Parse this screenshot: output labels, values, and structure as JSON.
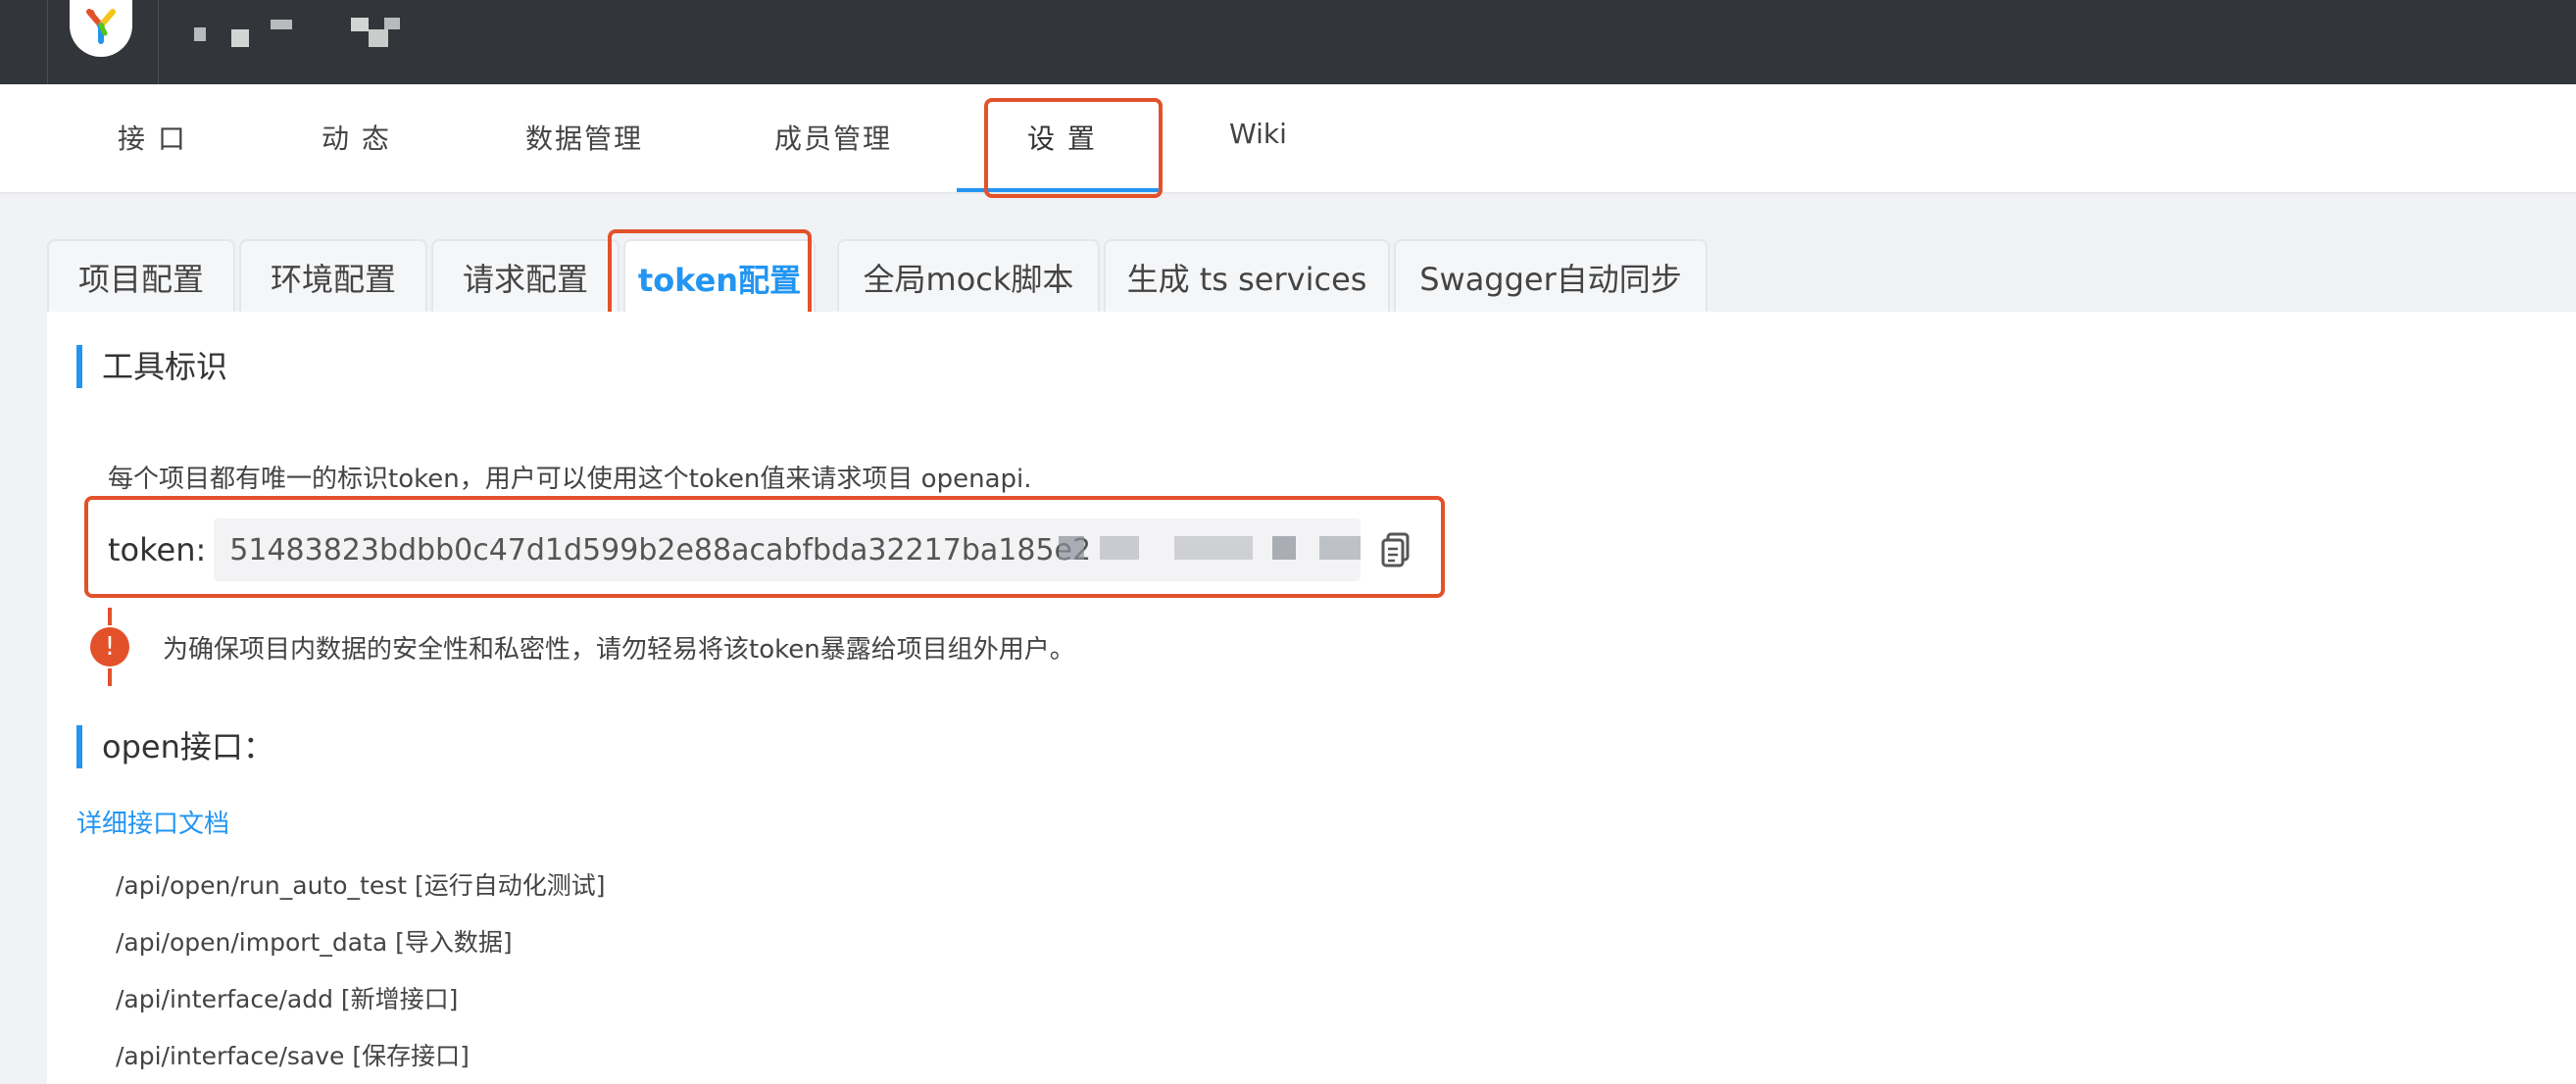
{
  "nav": {
    "items": [
      {
        "label": "接 口"
      },
      {
        "label": "动 态"
      },
      {
        "label": "数据管理"
      },
      {
        "label": "成员管理"
      },
      {
        "label": "设 置"
      },
      {
        "label": "Wiki"
      }
    ],
    "active_index": 4
  },
  "tabs": {
    "items": [
      {
        "label": "项目配置"
      },
      {
        "label": "环境配置"
      },
      {
        "label": "请求配置"
      },
      {
        "label": "token配置"
      },
      {
        "label": "全局mock脚本"
      },
      {
        "label": "生成 ts services"
      },
      {
        "label": "Swagger自动同步"
      }
    ],
    "active_index": 3
  },
  "tool_section": {
    "title": "工具标识",
    "description": "每个项目都有唯一的标识token，用户可以使用这个token值来请求项目 openapi.",
    "token_label": "token:",
    "token_value": "51483823bdbb0c47d1d599b2e88acabfbda32217ba185e2",
    "warning": "为确保项目内数据的安全性和私密性，请勿轻易将该token暴露给项目组外用户。"
  },
  "open_section": {
    "title": "open接口：",
    "doc_link": "详细接口文档",
    "apis": [
      "/api/open/run_auto_test [运行自动化测试]",
      "/api/open/import_data [导入数据]",
      "/api/interface/add [新增接口]",
      "/api/interface/save [保存接口]"
    ]
  },
  "colors": {
    "accent": "#2395f1",
    "highlight": "#e2512a",
    "header_bg": "#32363a"
  },
  "icons": {
    "logo": "yapi-logo-icon",
    "copy": "copy-icon",
    "warning": "exclamation-icon"
  }
}
